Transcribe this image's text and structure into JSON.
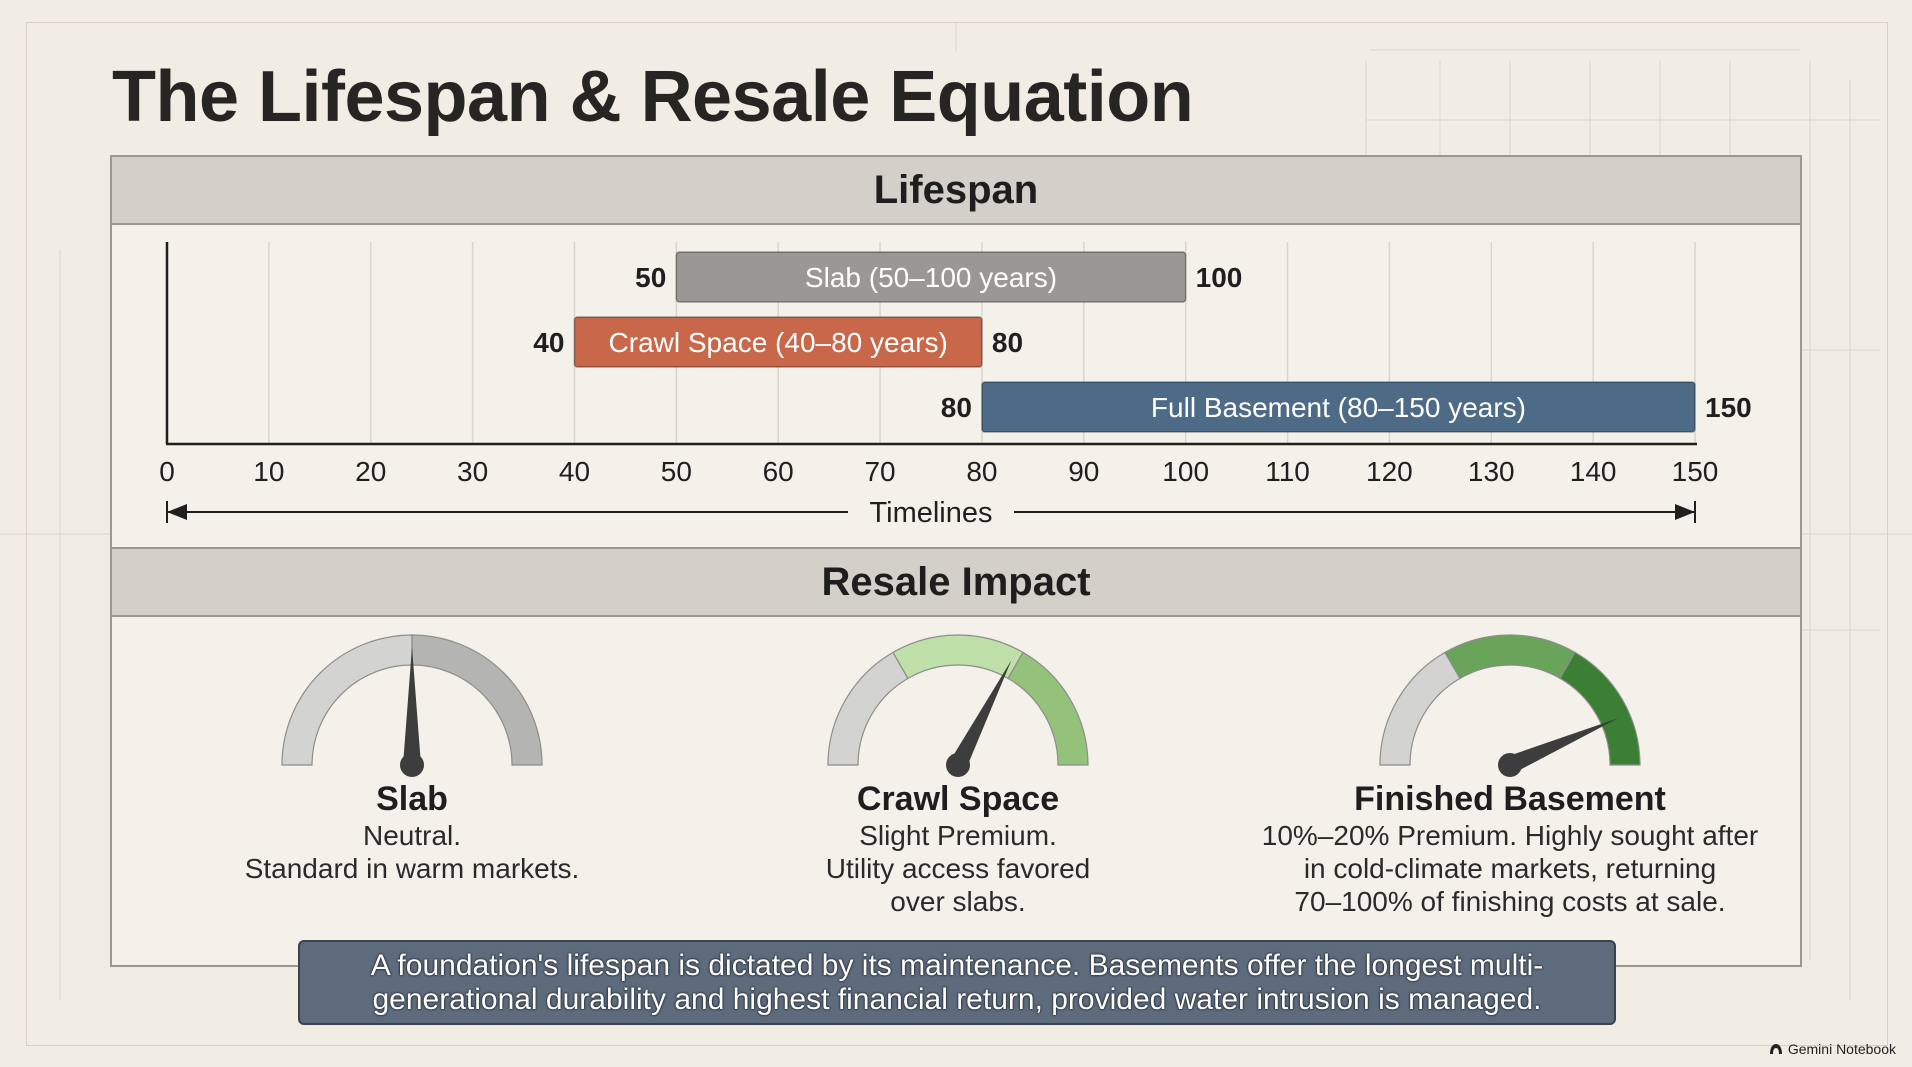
{
  "page": {
    "title": "The Lifespan & Resale Equation"
  },
  "lifespan": {
    "header": "Lifespan",
    "axis_title": "Timelines"
  },
  "chart_data": {
    "type": "range-bar",
    "title": "Lifespan",
    "xlabel": "Timelines",
    "xlim": [
      0,
      150
    ],
    "xticks": [
      0,
      10,
      20,
      30,
      40,
      50,
      60,
      70,
      80,
      90,
      100,
      110,
      120,
      130,
      140,
      150
    ],
    "grid": true,
    "bars": [
      {
        "label": "Slab (50–100 years)",
        "start": 50,
        "end": 100,
        "start_label": "50",
        "end_label": "100",
        "color": "#9a9896"
      },
      {
        "label": "Crawl Space (40–80 years)",
        "start": 40,
        "end": 80,
        "start_label": "40",
        "end_label": "80",
        "color": "#c9674a"
      },
      {
        "label": "Full Basement (80–150 years)",
        "start": 80,
        "end": 150,
        "start_label": "80",
        "end_label": "150",
        "color": "#4d6b87"
      }
    ]
  },
  "resale": {
    "header": "Resale Impact",
    "gauges": [
      {
        "label": "Slab",
        "description": "Neutral.\nStandard in warm markets.",
        "level": 0.5,
        "fills": [
          "#d3d3d1",
          "#b4b4b2"
        ],
        "needle_color": "#3d3d3d"
      },
      {
        "label": "Crawl Space",
        "description": "Slight Premium.\nUtility access favored\nover slabs.",
        "level": 0.65,
        "fills": [
          "#d3d3d1",
          "#bfe0a8",
          "#94c27a"
        ],
        "needle_color": "#3d3d3d"
      },
      {
        "label": "Finished Basement",
        "description": "10%–20% Premium. Highly sought after\nin cold-climate markets, returning\n70–100% of finishing costs at sale.",
        "level": 0.87,
        "fills": [
          "#d3d3d1",
          "#6aa35a",
          "#3a7f34"
        ],
        "needle_color": "#3d3d3d"
      }
    ]
  },
  "footer": {
    "text": "A foundation's lifespan is dictated by its maintenance. Basements offer the longest multi-generational durability and highest financial return, provided water intrusion is managed."
  },
  "watermark": {
    "text": "Gemini Notebook"
  }
}
